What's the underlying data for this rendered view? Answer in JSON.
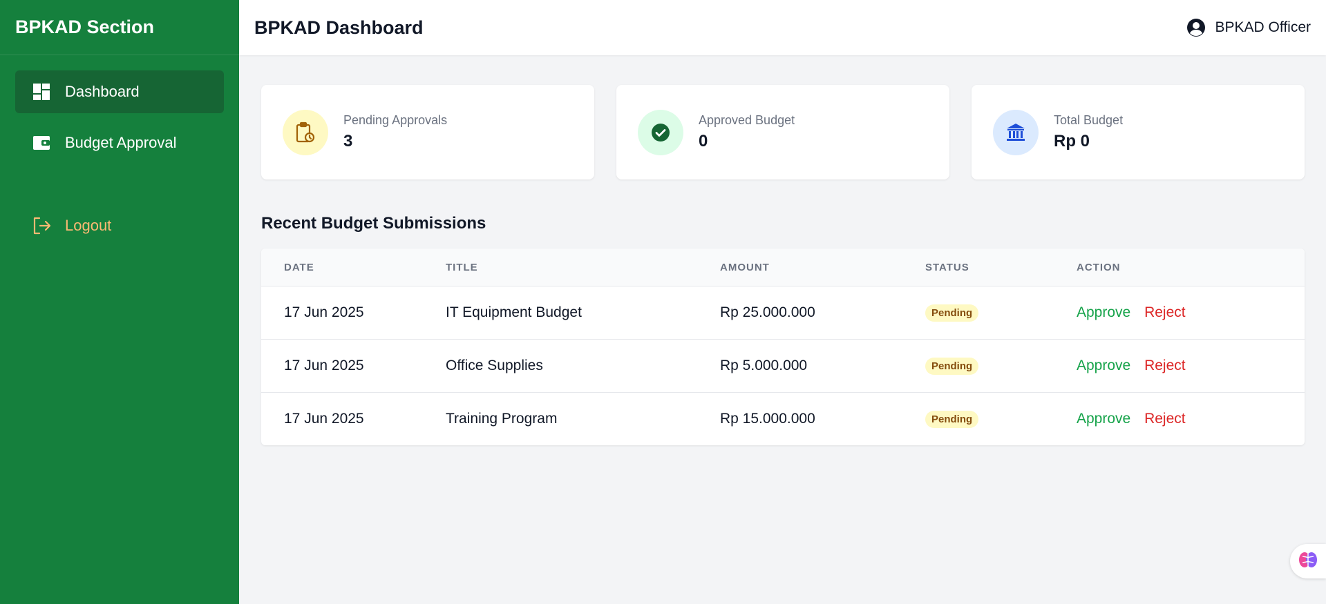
{
  "sidebar": {
    "brand": "BPKAD Section",
    "items": [
      {
        "label": "Dashboard",
        "icon": "dashboard-icon",
        "active": true
      },
      {
        "label": "Budget Approval",
        "icon": "wallet-icon",
        "active": false
      }
    ],
    "logout_label": "Logout"
  },
  "header": {
    "title": "BPKAD Dashboard",
    "user_name": "BPKAD Officer"
  },
  "stats": [
    {
      "label": "Pending Approvals",
      "value": "3",
      "icon": "clipboard-clock-icon",
      "color": "#fef9c3"
    },
    {
      "label": "Approved Budget",
      "value": "0",
      "icon": "check-circle-icon",
      "color": "#dcfce7"
    },
    {
      "label": "Total Budget",
      "value": "Rp 0",
      "icon": "bank-icon",
      "color": "#dbeafe"
    }
  ],
  "submissions": {
    "title": "Recent Budget Submissions",
    "columns": [
      "DATE",
      "TITLE",
      "AMOUNT",
      "STATUS",
      "ACTION"
    ],
    "rows": [
      {
        "date": "17 Jun 2025",
        "title": "IT Equipment Budget",
        "amount": "Rp 25.000.000",
        "status": "Pending",
        "approve": "Approve",
        "reject": "Reject"
      },
      {
        "date": "17 Jun 2025",
        "title": "Office Supplies",
        "amount": "Rp 5.000.000",
        "status": "Pending",
        "approve": "Approve",
        "reject": "Reject"
      },
      {
        "date": "17 Jun 2025",
        "title": "Training Program",
        "amount": "Rp 15.000.000",
        "status": "Pending",
        "approve": "Approve",
        "reject": "Reject"
      }
    ]
  },
  "colors": {
    "sidebar": "#15803d",
    "sidebar_active": "#166534",
    "logout": "#fdba74",
    "approve": "#16a34a",
    "reject": "#dc2626",
    "pending_badge": "#fef9c3"
  }
}
